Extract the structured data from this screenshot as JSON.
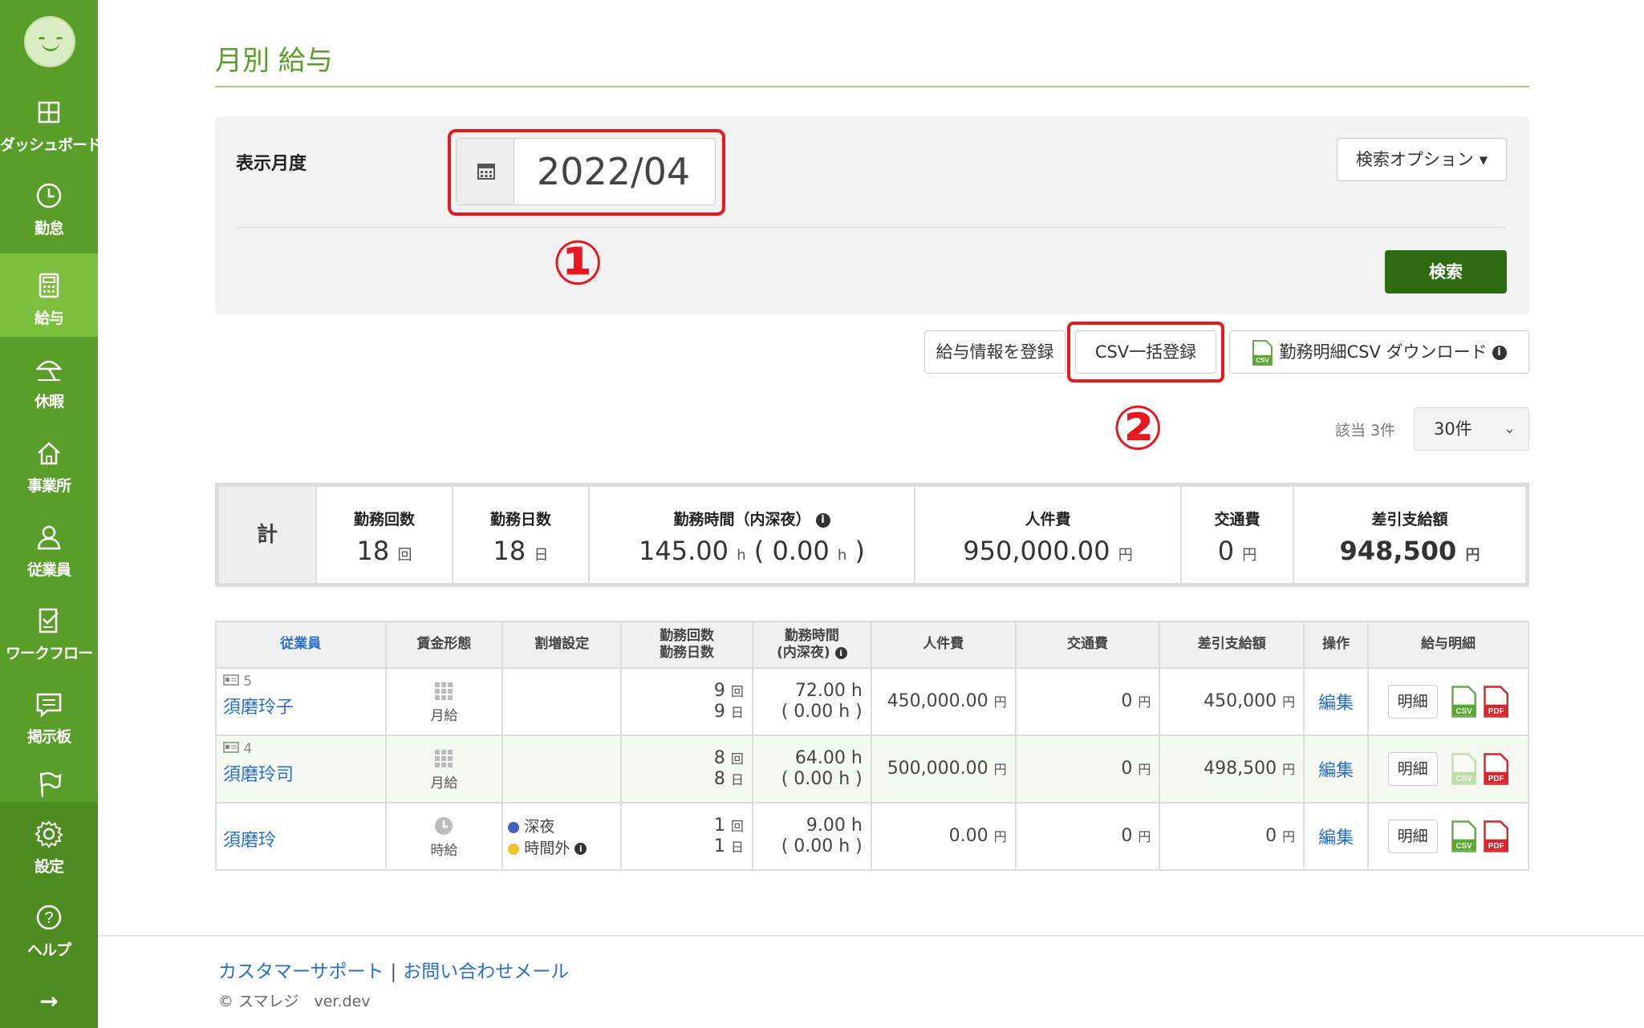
{
  "sidebar": {
    "items": [
      {
        "label": "ダッシュボード",
        "icon": "grid-icon"
      },
      {
        "label": "勤怠",
        "icon": "clock-icon"
      },
      {
        "label": "給与",
        "icon": "calculator-icon",
        "active": true
      },
      {
        "label": "休暇",
        "icon": "umbrella-icon"
      },
      {
        "label": "事業所",
        "icon": "home-icon"
      },
      {
        "label": "従業員",
        "icon": "person-icon"
      },
      {
        "label": "ワークフロー",
        "icon": "checklist-icon"
      },
      {
        "label": "掲示板",
        "icon": "message-icon"
      },
      {
        "label": "",
        "icon": "flag-icon"
      },
      {
        "label": "設定",
        "icon": "gear-icon"
      },
      {
        "label": "ヘルプ",
        "icon": "help-icon"
      }
    ],
    "expand": "→"
  },
  "page": {
    "title": "月別 給与"
  },
  "search": {
    "month_label": "表示月度",
    "month_value": "2022/04",
    "options_label": "検索オプション ▾",
    "search_button": "検索",
    "annotation_1": "①"
  },
  "actions": {
    "register": "給与情報を登録",
    "csv_bulk": "CSV一括登録",
    "csv_download": "勤務明細CSV ダウンロード",
    "annotation_2": "②"
  },
  "paging": {
    "count": "該当 3件",
    "per_page": "30件"
  },
  "summary": {
    "total_label": "計",
    "work_count": {
      "h": "勤務回数",
      "v": "18",
      "u": "回"
    },
    "work_days": {
      "h": "勤務日数",
      "v": "18",
      "u": "日"
    },
    "work_hours": {
      "h": "勤務時間（内深夜）",
      "v": "145.00",
      "u": "h",
      "v2": "0.00",
      "u2": "h"
    },
    "labor_cost": {
      "h": "人件費",
      "v": "950,000.00",
      "u": "円"
    },
    "transport": {
      "h": "交通費",
      "v": "0",
      "u": "円"
    },
    "net_pay": {
      "h": "差引支給額",
      "v": "948,500",
      "u": "円"
    }
  },
  "table": {
    "headers": [
      "従業員",
      "賃金形態",
      "割増設定",
      "勤務回数\n勤務日数",
      "勤務時間\n(内深夜)",
      "人件費",
      "交通費",
      "差引支給額",
      "操作",
      "給与明細"
    ],
    "rows": [
      {
        "id": "5",
        "name": "須磨玲子",
        "wage": "月給",
        "premium": [],
        "count": "9",
        "days": "9",
        "hours": "72.00 h",
        "night": "( 0.00 h )",
        "cost": "450,000.00",
        "transport": "0",
        "net": "450,000",
        "edit": "編集",
        "detail": "明細"
      },
      {
        "id": "4",
        "name": "須磨玲司",
        "wage": "月給",
        "premium": [],
        "count": "8",
        "days": "8",
        "hours": "64.00 h",
        "night": "( 0.00 h )",
        "cost": "500,000.00",
        "transport": "0",
        "net": "498,500",
        "edit": "編集",
        "detail": "明細"
      },
      {
        "id": "",
        "name": "須磨玲",
        "wage": "時給",
        "premium": [
          "深夜",
          "時間外"
        ],
        "count": "1",
        "days": "1",
        "hours": "9.00 h",
        "night": "( 0.00 h )",
        "cost": "0.00",
        "transport": "0",
        "net": "0",
        "edit": "編集",
        "detail": "明細"
      }
    ],
    "unit_count": "回",
    "unit_day": "日",
    "unit_yen": "円"
  },
  "footer": {
    "support": "カスタマーサポート",
    "separator": "|",
    "mail": "お問い合わせメール",
    "copyright": "© スマレジ　ver.dev"
  },
  "colors": {
    "brand_green": "#5a9e2a",
    "active_green": "#7cbf3f",
    "button_dark": "#2e6a12",
    "annotation_red": "#e8181e",
    "link_blue": "#2a6fc9"
  }
}
